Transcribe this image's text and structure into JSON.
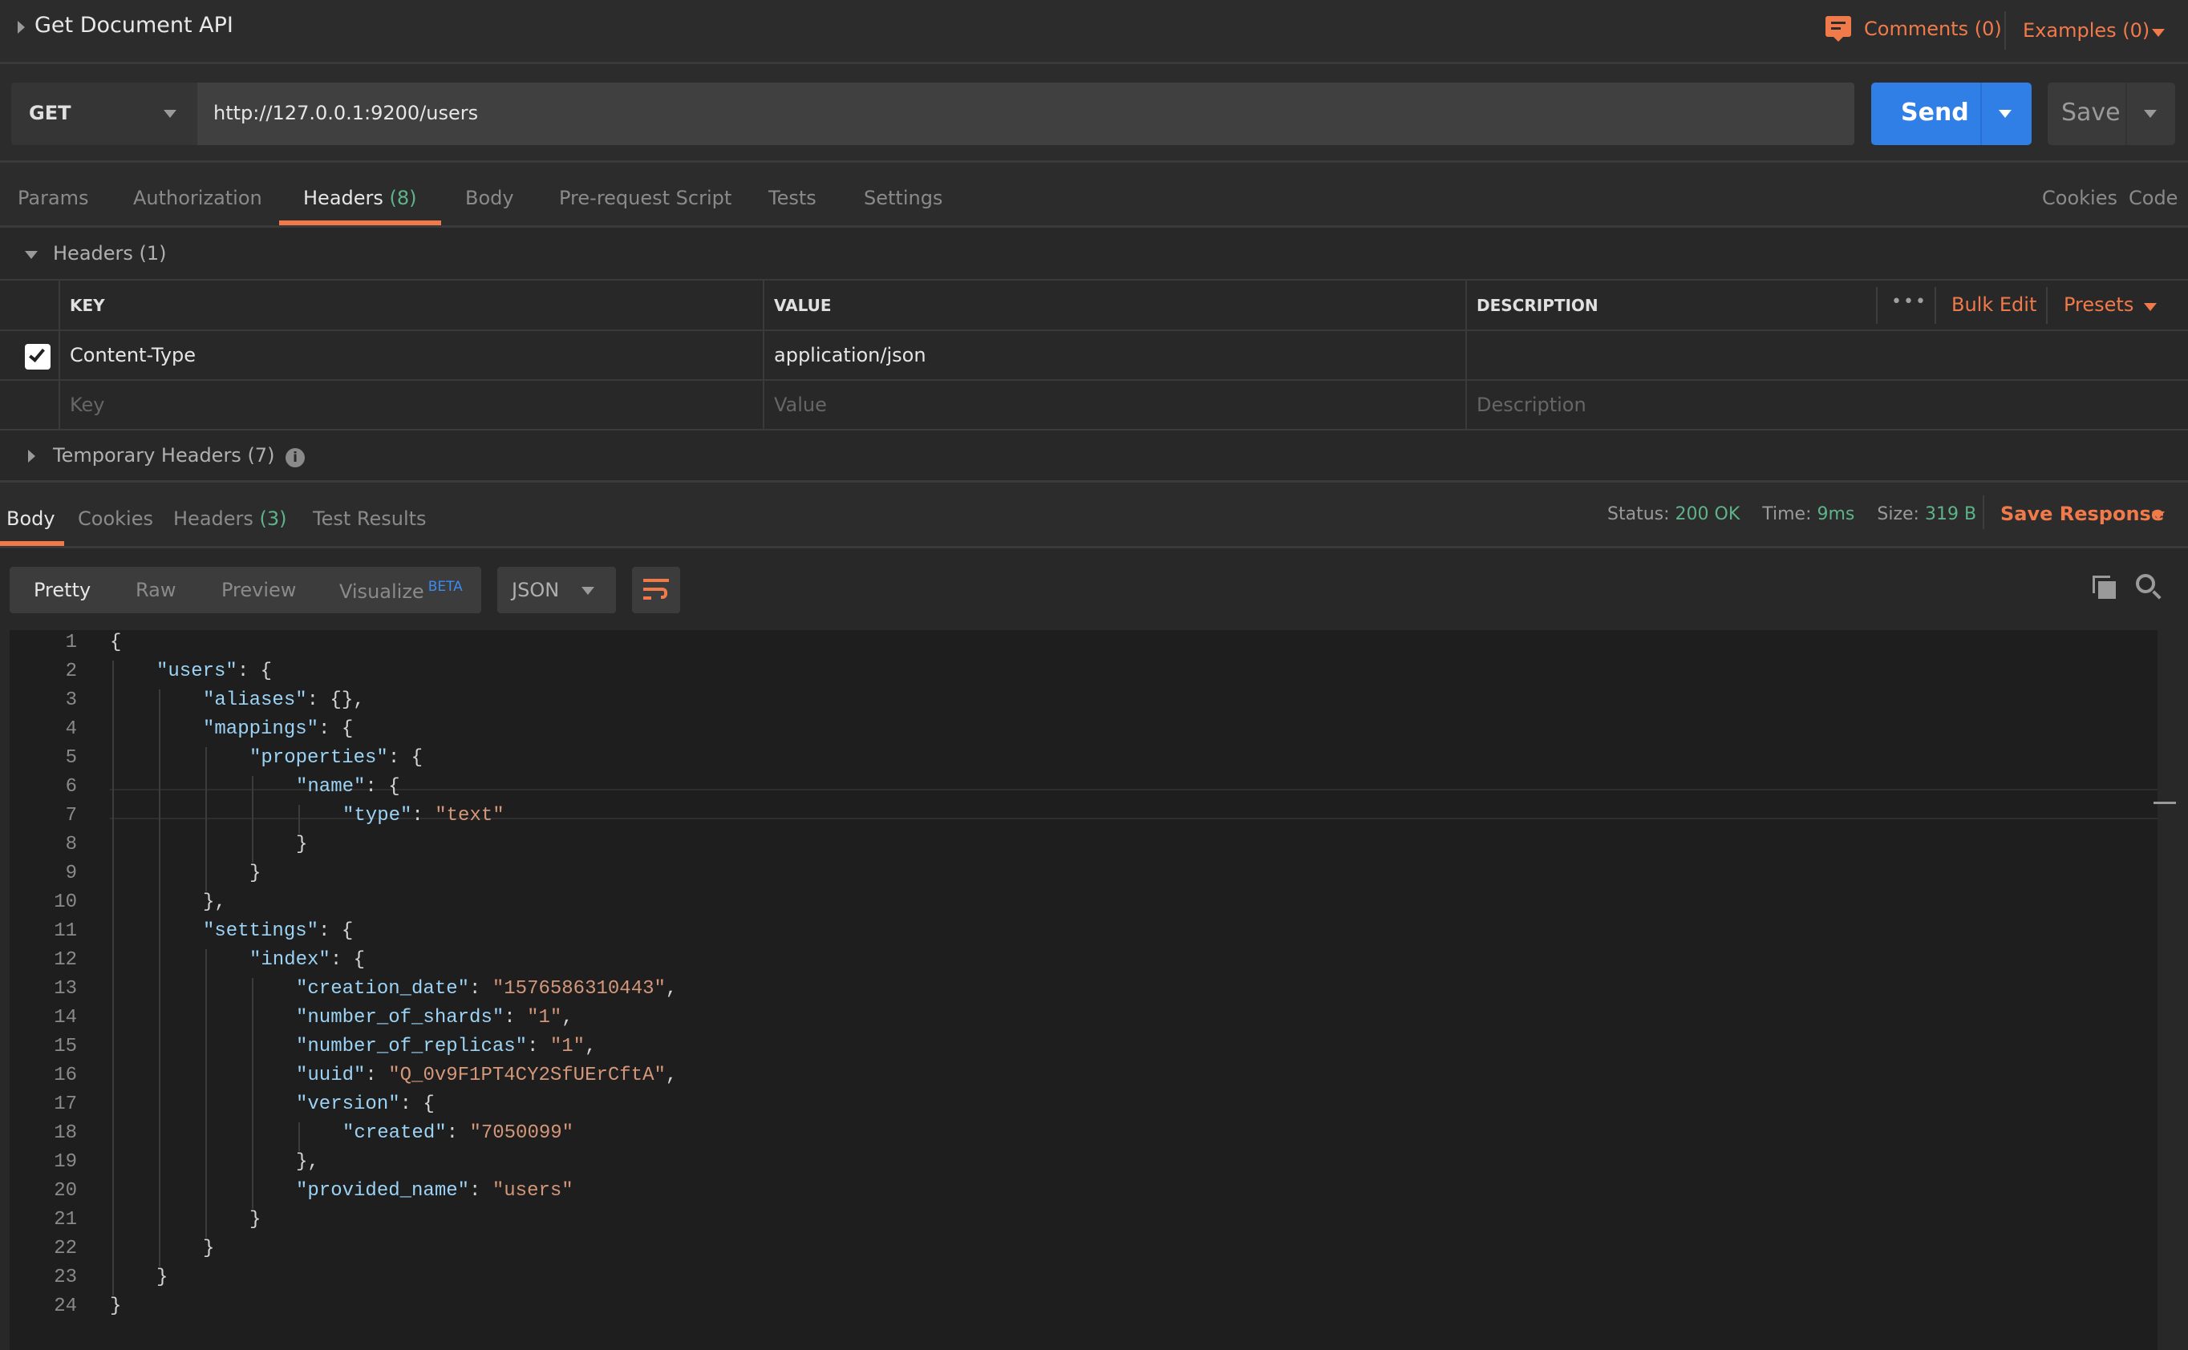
{
  "header": {
    "title": "Get Document API",
    "comments": "Comments (0)",
    "examples": "Examples (0)"
  },
  "request": {
    "method": "GET",
    "url": "http://127.0.0.1:9200/users",
    "send": "Send",
    "save": "Save"
  },
  "request_tabs": [
    {
      "label": "Params"
    },
    {
      "label": "Authorization"
    },
    {
      "label": "Headers",
      "count": "(8)",
      "active": true
    },
    {
      "label": "Body"
    },
    {
      "label": "Pre-request Script"
    },
    {
      "label": "Tests"
    },
    {
      "label": "Settings"
    }
  ],
  "request_links": {
    "cookies": "Cookies",
    "code": "Code"
  },
  "headers_section": {
    "title": "Headers (1)",
    "columns": {
      "key": "KEY",
      "value": "VALUE",
      "description": "DESCRIPTION"
    },
    "more": "•••",
    "bulk_edit": "Bulk Edit",
    "presets": "Presets",
    "rows": [
      {
        "checked": true,
        "key": "Content-Type",
        "value": "application/json",
        "description": ""
      }
    ],
    "placeholders": {
      "key": "Key",
      "value": "Value",
      "description": "Description"
    },
    "temporary": "Temporary Headers (7)"
  },
  "response_tabs": [
    {
      "label": "Body",
      "active": true
    },
    {
      "label": "Cookies"
    },
    {
      "label": "Headers",
      "count": "(3)"
    },
    {
      "label": "Test Results"
    }
  ],
  "response_meta": {
    "status_label": "Status:",
    "status": "200 OK",
    "time_label": "Time:",
    "time": "9ms",
    "size_label": "Size:",
    "size": "319 B",
    "save_response": "Save Response"
  },
  "view_modes": {
    "pretty": "Pretty",
    "raw": "Raw",
    "preview": "Preview",
    "visualize": "Visualize",
    "beta": "BETA",
    "format": "JSON"
  },
  "colors": {
    "accent": "#f07a4a",
    "send": "#2f7fe6",
    "success": "#5fb38a",
    "json_key": "#9cd3f5",
    "json_string": "#d4977a"
  },
  "code_lines": [
    {
      "n": "1",
      "indent": 0,
      "parts": [
        [
          "p",
          "{"
        ]
      ]
    },
    {
      "n": "2",
      "indent": 1,
      "parts": [
        [
          "k",
          "\"users\""
        ],
        [
          "p",
          ": {"
        ]
      ]
    },
    {
      "n": "3",
      "indent": 2,
      "parts": [
        [
          "k",
          "\"aliases\""
        ],
        [
          "p",
          ": {},"
        ]
      ]
    },
    {
      "n": "4",
      "indent": 2,
      "parts": [
        [
          "k",
          "\"mappings\""
        ],
        [
          "p",
          ": {"
        ]
      ]
    },
    {
      "n": "5",
      "indent": 3,
      "parts": [
        [
          "k",
          "\"properties\""
        ],
        [
          "p",
          ": {"
        ]
      ]
    },
    {
      "n": "6",
      "indent": 4,
      "parts": [
        [
          "k",
          "\"name\""
        ],
        [
          "p",
          ": {"
        ]
      ]
    },
    {
      "n": "7",
      "indent": 5,
      "parts": [
        [
          "k",
          "\"type\""
        ],
        [
          "p",
          ": "
        ],
        [
          "s",
          "\"text\""
        ]
      ]
    },
    {
      "n": "8",
      "indent": 4,
      "parts": [
        [
          "p",
          "}"
        ]
      ]
    },
    {
      "n": "9",
      "indent": 3,
      "parts": [
        [
          "p",
          "}"
        ]
      ]
    },
    {
      "n": "10",
      "indent": 2,
      "parts": [
        [
          "p",
          "},"
        ]
      ]
    },
    {
      "n": "11",
      "indent": 2,
      "parts": [
        [
          "k",
          "\"settings\""
        ],
        [
          "p",
          ": {"
        ]
      ]
    },
    {
      "n": "12",
      "indent": 3,
      "parts": [
        [
          "k",
          "\"index\""
        ],
        [
          "p",
          ": {"
        ]
      ]
    },
    {
      "n": "13",
      "indent": 4,
      "parts": [
        [
          "k",
          "\"creation_date\""
        ],
        [
          "p",
          ": "
        ],
        [
          "s",
          "\"1576586310443\""
        ],
        [
          "p",
          ","
        ]
      ]
    },
    {
      "n": "14",
      "indent": 4,
      "parts": [
        [
          "k",
          "\"number_of_shards\""
        ],
        [
          "p",
          ": "
        ],
        [
          "s",
          "\"1\""
        ],
        [
          "p",
          ","
        ]
      ]
    },
    {
      "n": "15",
      "indent": 4,
      "parts": [
        [
          "k",
          "\"number_of_replicas\""
        ],
        [
          "p",
          ": "
        ],
        [
          "s",
          "\"1\""
        ],
        [
          "p",
          ","
        ]
      ]
    },
    {
      "n": "16",
      "indent": 4,
      "parts": [
        [
          "k",
          "\"uuid\""
        ],
        [
          "p",
          ": "
        ],
        [
          "s",
          "\"Q_0v9F1PT4CY2SfUErCftA\""
        ],
        [
          "p",
          ","
        ]
      ]
    },
    {
      "n": "17",
      "indent": 4,
      "parts": [
        [
          "k",
          "\"version\""
        ],
        [
          "p",
          ": {"
        ]
      ]
    },
    {
      "n": "18",
      "indent": 5,
      "parts": [
        [
          "k",
          "\"created\""
        ],
        [
          "p",
          ": "
        ],
        [
          "s",
          "\"7050099\""
        ]
      ]
    },
    {
      "n": "19",
      "indent": 4,
      "parts": [
        [
          "p",
          "},"
        ]
      ]
    },
    {
      "n": "20",
      "indent": 4,
      "parts": [
        [
          "k",
          "\"provided_name\""
        ],
        [
          "p",
          ": "
        ],
        [
          "s",
          "\"users\""
        ]
      ]
    },
    {
      "n": "21",
      "indent": 3,
      "parts": [
        [
          "p",
          "}"
        ]
      ]
    },
    {
      "n": "22",
      "indent": 2,
      "parts": [
        [
          "p",
          "}"
        ]
      ]
    },
    {
      "n": "23",
      "indent": 1,
      "parts": [
        [
          "p",
          "}"
        ]
      ]
    },
    {
      "n": "24",
      "indent": 0,
      "parts": [
        [
          "p",
          "}"
        ]
      ]
    }
  ]
}
